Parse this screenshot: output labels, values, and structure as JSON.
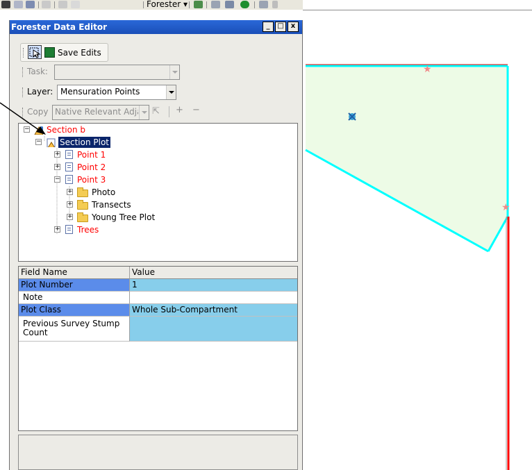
{
  "app_toolbar": {
    "forester_menu": "Forester ▾"
  },
  "window": {
    "title": "Forester Data Editor",
    "controls": {
      "minimize": "_",
      "maximize": "□",
      "close": "x"
    }
  },
  "edit_toolbar": {
    "save_label": "Save Edits"
  },
  "task_bar": {
    "label": "Task:",
    "value": ""
  },
  "layer_bar": {
    "label": "Layer:",
    "value": "Mensuration Points"
  },
  "copy_bar": {
    "label": "Copy",
    "value": "Native Relevant Adja",
    "plus": "+",
    "minus": "−"
  },
  "tree": {
    "root": "Section b",
    "plot": "Section Plot",
    "point1": "Point 1",
    "point2": "Point 2",
    "point3": "Point 3",
    "photo": "Photo",
    "transects": "Transects",
    "young_tree_plot": "Young Tree Plot",
    "trees": "Trees"
  },
  "grid": {
    "headers": {
      "field": "Field Name",
      "value": "Value"
    },
    "rows": [
      {
        "field": "Plot Number",
        "value": "1"
      },
      {
        "field": "Note",
        "value": ""
      },
      {
        "field": "Plot Class",
        "value": "Whole Sub-Compartment"
      },
      {
        "field": "Previous Survey Stump Count",
        "value": ""
      }
    ]
  },
  "colors": {
    "selected_field": "#5b8cea",
    "value_bg": "#87ceeb",
    "polygon_fill": "#edfbe6",
    "polygon_edge": "#00ffff",
    "boundary_red": "#ff0000",
    "required_text": "#ff0000",
    "titlebar": "#1f5bd1"
  }
}
